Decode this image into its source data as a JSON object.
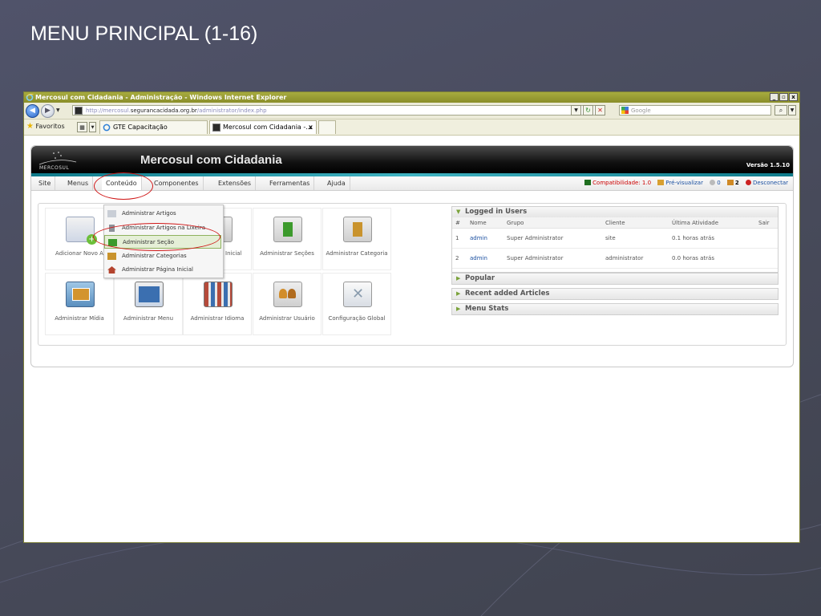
{
  "slide": {
    "title": "MENU PRINCIPAL (1-16)"
  },
  "browser": {
    "window_title": "Mercosul com Cidadania - Administração - Windows Internet Explorer",
    "window_controls": [
      "_",
      "▫",
      "x"
    ],
    "address": {
      "prefix": "http://mercosul.",
      "domain": "segurancacidada.org.br",
      "path": "/administrator/index.php"
    },
    "search_placeholder": "Google",
    "favorites_label": "Favoritos",
    "tabs": [
      {
        "label": "GTE Capacitação"
      },
      {
        "label": "Mercosul com Cidadania -..."
      }
    ],
    "tab_close": "x"
  },
  "joomla": {
    "logo_text": "MERCOSUL",
    "site_title": "Mercosul com Cidadania",
    "version": "Versão 1.5.10",
    "menu": [
      "Site",
      "Menus",
      "Conteúdo",
      "Componentes",
      "Extensões",
      "Ferramentas",
      "Ajuda"
    ],
    "status": {
      "compat": "Compatibilidade: 1.0",
      "preview": "Pré-visualizar",
      "messages": "0",
      "users": "2",
      "logout": "Desconectar"
    },
    "dropdown": [
      "Administrar Artigos",
      "Administrar Artigos na Lixeira",
      "Administrar Seção",
      "Administrar Categorias",
      "Administrar Página Inicial"
    ],
    "cpanel": [
      {
        "label": "Adicionar Novo A",
        "icon": "add-article-icon",
        "color": "#9cc24a"
      },
      {
        "label": "",
        "icon": "hidden-icon",
        "color": "#cccccc"
      },
      {
        "label": "trar Página Inicial",
        "icon": "home-icon",
        "color": "#b4442e"
      },
      {
        "label": "Administrar Seções",
        "icon": "sections-icon",
        "color": "#3c9a2c"
      },
      {
        "label": "Administrar Categoria",
        "icon": "categories-icon",
        "color": "#c9932d"
      },
      {
        "label": "Administrar Mídia",
        "icon": "media-icon",
        "color": "#d3942e"
      },
      {
        "label": "Administrar Menu",
        "icon": "menu-icon",
        "color": "#3b6fb0"
      },
      {
        "label": "Administrar Idioma",
        "icon": "language-icon",
        "color": "#b54a3a"
      },
      {
        "label": "Administrar Usuário",
        "icon": "users-icon",
        "color": "#d28d2a"
      },
      {
        "label": "Configuração Global",
        "icon": "config-icon",
        "color": "#8a9cae"
      }
    ],
    "logged_in": {
      "title": "Logged in Users",
      "columns": [
        "#",
        "Nome",
        "Grupo",
        "Cliente",
        "Última Atividade",
        "Sair"
      ],
      "rows": [
        {
          "n": "1",
          "nome": "admin",
          "grupo": "Super Administrator",
          "cliente": "site",
          "atividade": "0.1 horas atrás"
        },
        {
          "n": "2",
          "nome": "admin",
          "grupo": "Super Administrator",
          "cliente": "administrator",
          "atividade": "0.0 horas atrás"
        }
      ]
    },
    "modules": [
      "Popular",
      "Recent added Articles",
      "Menu Stats"
    ]
  }
}
